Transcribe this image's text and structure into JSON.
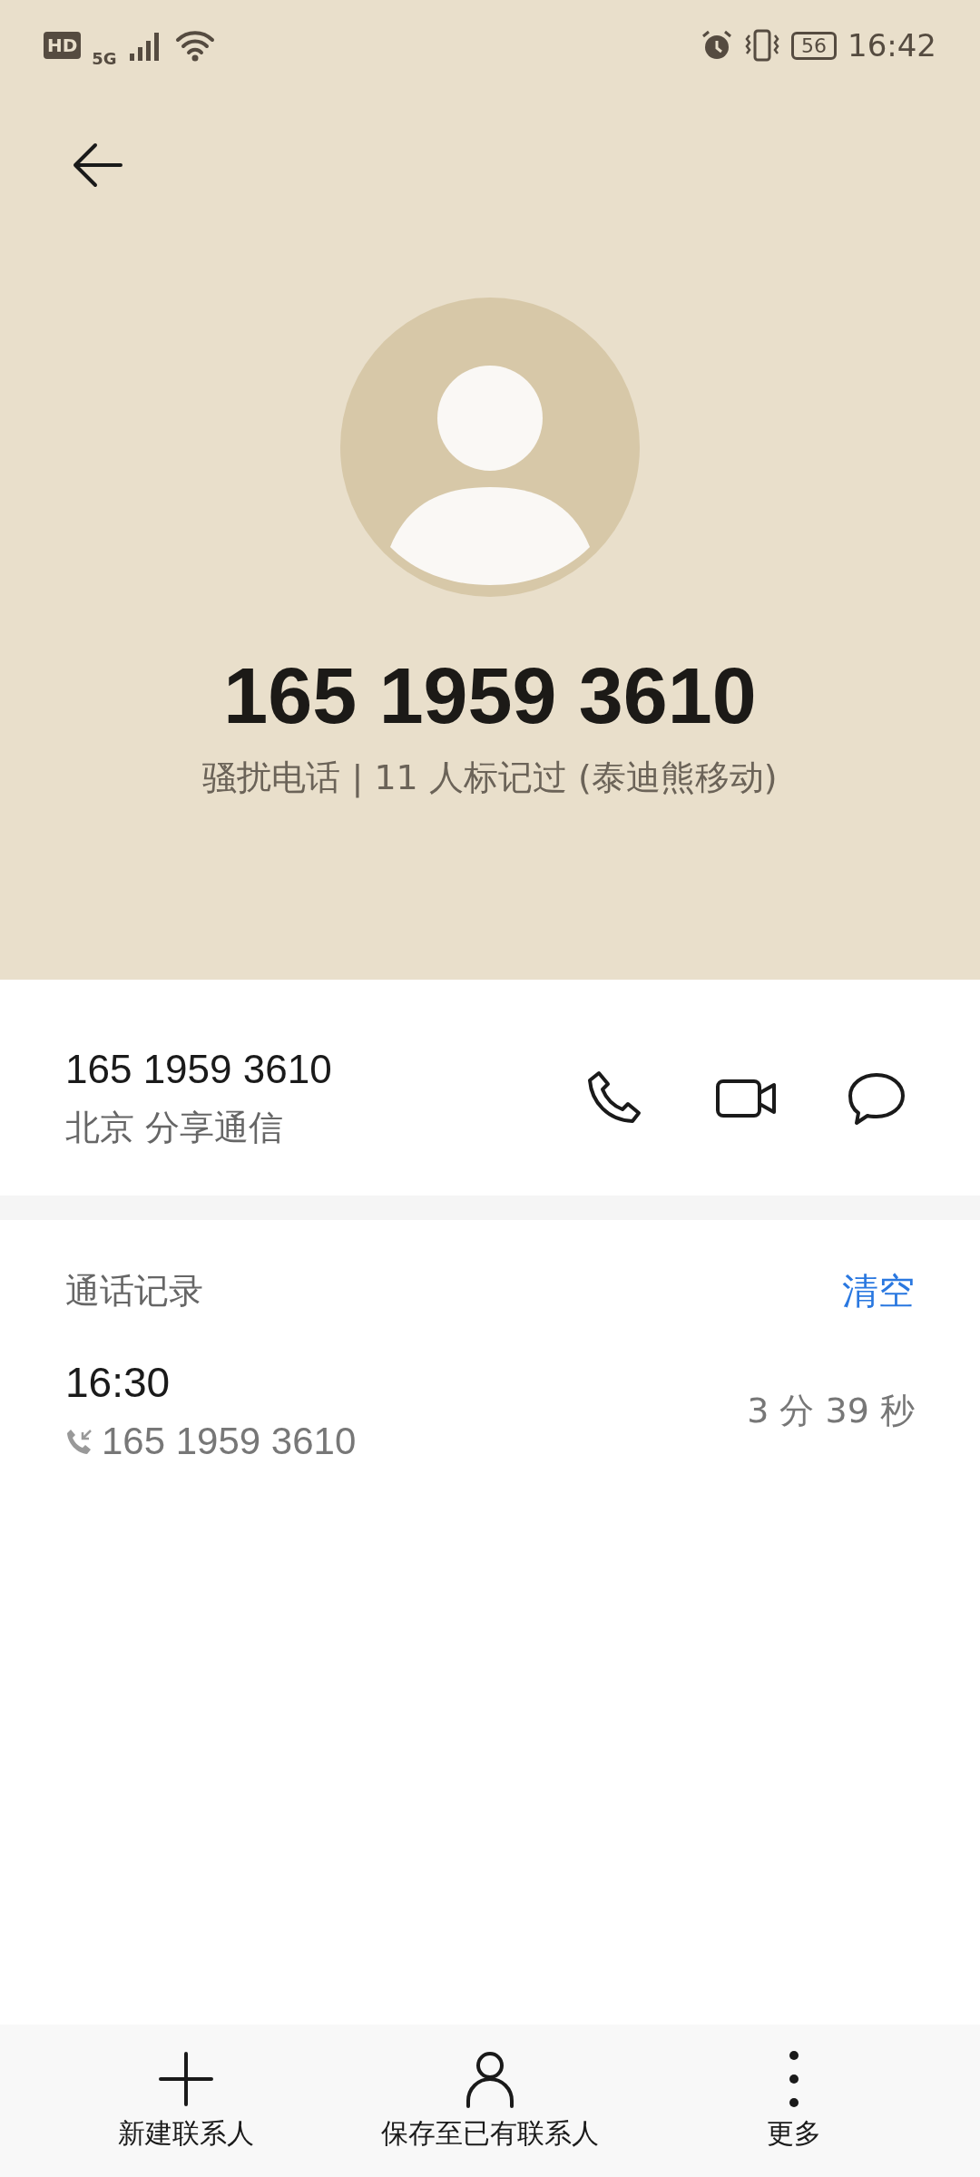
{
  "status_bar": {
    "time": "16:42",
    "network": "5G",
    "battery": "56",
    "hd": "HD"
  },
  "header": {
    "number": "165 1959 3610",
    "info": "骚扰电话 | 11 人标记过 (泰迪熊移动)"
  },
  "number_card": {
    "number": "165 1959 3610",
    "location": "北京 分享通信"
  },
  "call_log": {
    "title": "通话记录",
    "clear": "清空",
    "entries": [
      {
        "time": "16:30",
        "number": "165 1959 3610",
        "duration": "3 分 39 秒",
        "kind": "incoming"
      }
    ]
  },
  "bottom_bar": [
    {
      "kind": "add",
      "label": "新建联系人"
    },
    {
      "kind": "person",
      "label": "保存至已有联系人"
    },
    {
      "kind": "more",
      "label": "更多"
    }
  ]
}
